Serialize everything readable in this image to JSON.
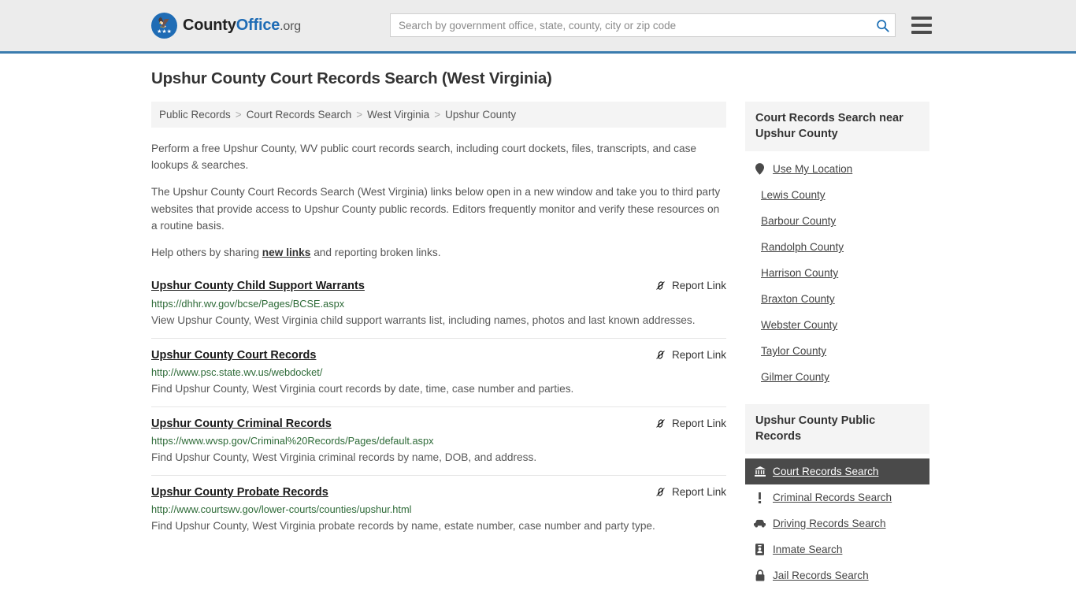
{
  "header": {
    "logo": {
      "icon": "eagle-shield-icon",
      "part1": "County",
      "part2": "Office",
      "part3": ".org"
    },
    "search": {
      "placeholder": "Search by government office, state, county, city or zip code",
      "value": "",
      "icon": "search-icon"
    },
    "menu_icon": "hamburger-menu-icon"
  },
  "page_title": "Upshur County Court Records Search (West Virginia)",
  "breadcrumb": {
    "separator": ">",
    "items": [
      {
        "label": "Public Records"
      },
      {
        "label": "Court Records Search"
      },
      {
        "label": "West Virginia"
      },
      {
        "label": "Upshur County"
      }
    ]
  },
  "intro": {
    "p1": "Perform a free Upshur County, WV public court records search, including court dockets, files, transcripts, and case lookups & searches.",
    "p2": "The Upshur County Court Records Search (West Virginia) links below open in a new window and take you to third party websites that provide access to Upshur County public records. Editors frequently monitor and verify these resources on a routine basis.",
    "p3_before": "Help others by sharing ",
    "p3_link": "new links",
    "p3_after": " and reporting broken links."
  },
  "report_link_label": "Report Link",
  "report_link_icon": "broken-link-icon",
  "results": [
    {
      "title": "Upshur County Child Support Warrants",
      "url": "https://dhhr.wv.gov/bcse/Pages/BCSE.aspx",
      "description": "View Upshur County, West Virginia child support warrants list, including names, photos and last known addresses."
    },
    {
      "title": "Upshur County Court Records",
      "url": "http://www.psc.state.wv.us/webdocket/",
      "description": "Find Upshur County, West Virginia court records by date, time, case number and parties."
    },
    {
      "title": "Upshur County Criminal Records",
      "url": "https://www.wvsp.gov/Criminal%20Records/Pages/default.aspx",
      "description": "Find Upshur County, West Virginia criminal records by name, DOB, and address."
    },
    {
      "title": "Upshur County Probate Records",
      "url": "http://www.courtswv.gov/lower-courts/counties/upshur.html",
      "description": "Find Upshur County, West Virginia probate records by name, estate number, case number and party type."
    }
  ],
  "sidebar": {
    "nearby": {
      "heading": "Court Records Search near Upshur County",
      "items": [
        {
          "label": "Use My Location",
          "icon": "map-pin-icon"
        },
        {
          "label": "Lewis County",
          "icon": ""
        },
        {
          "label": "Barbour County",
          "icon": ""
        },
        {
          "label": "Randolph County",
          "icon": ""
        },
        {
          "label": "Harrison County",
          "icon": ""
        },
        {
          "label": "Braxton County",
          "icon": ""
        },
        {
          "label": "Webster County",
          "icon": ""
        },
        {
          "label": "Taylor County",
          "icon": ""
        },
        {
          "label": "Gilmer County",
          "icon": ""
        }
      ]
    },
    "public_records": {
      "heading": "Upshur County Public Records",
      "items": [
        {
          "label": "Court Records Search",
          "icon": "courthouse-icon",
          "active": true
        },
        {
          "label": "Criminal Records Search",
          "icon": "exclamation-icon",
          "active": false
        },
        {
          "label": "Driving Records Search",
          "icon": "car-icon",
          "active": false
        },
        {
          "label": "Inmate Search",
          "icon": "id-badge-icon",
          "active": false
        },
        {
          "label": "Jail Records Search",
          "icon": "lock-icon",
          "active": false
        }
      ]
    }
  },
  "colors": {
    "brand_blue": "#1f6cb5",
    "header_border": "#3b7cae",
    "url_green": "#2d6a37",
    "active_bg": "#4a4a4a"
  }
}
